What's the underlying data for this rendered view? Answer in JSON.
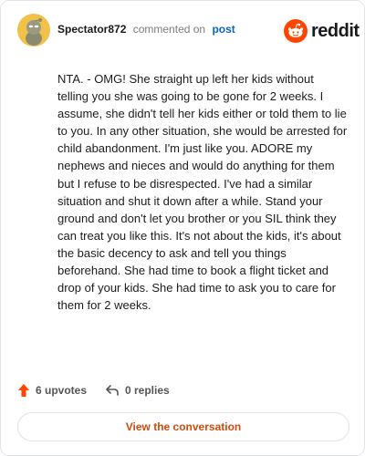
{
  "header": {
    "username": "Spectator872",
    "action": "commented on",
    "target": "post",
    "logo_text": "reddit"
  },
  "comment": {
    "text": "NTA. - OMG! She straight up left her kids without telling you she was going to be gone for 2 weeks. I assume, she didn't tell her kids either or told them to lie to you. In any other situation, she would be arrested for child abandonment. I'm just like you. ADORE my nephews and nieces and would do anything for them but I refuse to be disrespected. I've had a similar situation and shut it down after a while. Stand your ground and don't let you brother or you SIL think they can treat you like this. It's not about the kids, it's about the basic decency to ask and tell you things beforehand. She had time to book a flight ticket and drop of your kids. She had time to ask you to care for them for 2 weeks."
  },
  "actions": {
    "upvotes": "6 upvotes",
    "replies": "0 replies"
  },
  "cta": {
    "label": "View the conversation"
  },
  "colors": {
    "accent": "#ff4500",
    "cta_text": "#d14a0e",
    "link": "#0a66c2",
    "avatar_bg": "#f2c14a"
  },
  "icons": {
    "avatar": "snoo-avatar-icon",
    "logo": "reddit-logo-icon",
    "upvote": "upvote-arrow-icon",
    "reply": "reply-arrow-icon"
  }
}
